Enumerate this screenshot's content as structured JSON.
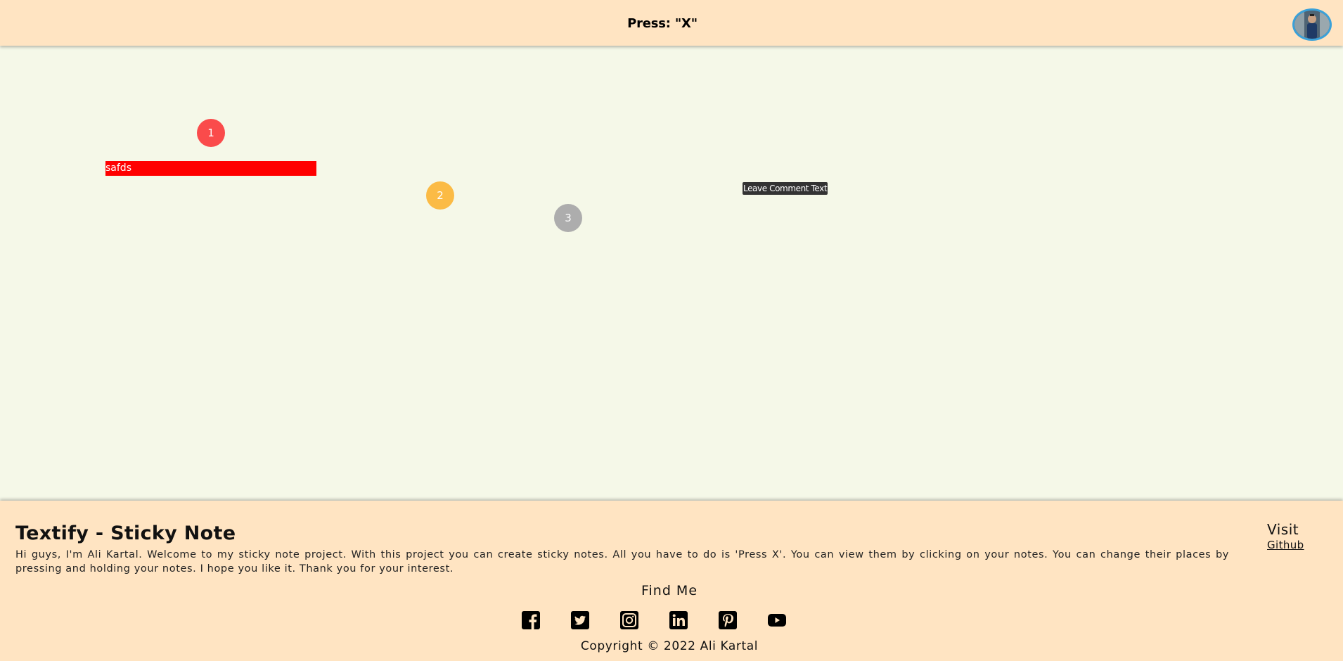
{
  "header": {
    "title": "Press: \"X\""
  },
  "notes": [
    {
      "number": "1",
      "color": "#fa4b4b"
    },
    {
      "number": "2",
      "color": "#fbbb45"
    },
    {
      "number": "3",
      "color": "#adadad"
    }
  ],
  "note_text": "safds",
  "comment_tooltip": "Leave Comment Text",
  "footer": {
    "title": "Textify - Sticky Note",
    "description": "Hi guys, I'm Ali Kartal. Welcome to my sticky note project. With this project you can create sticky notes. All you have to do is 'Press X'. You can view them by clicking on your notes. You can change their places by pressing and holding your notes. I hope you like it. Thank you for your interest.",
    "visit_label": "Visit",
    "github_link": "Github",
    "find_me": "Find Me",
    "social_icons": [
      "facebook-icon",
      "twitter-icon",
      "instagram-icon",
      "linkedin-icon",
      "pinterest-icon",
      "youtube-icon"
    ],
    "copyright": "Copyright © 2022 Ali Kartal"
  },
  "colors": {
    "header_bg": "#ffe4c2",
    "canvas_bg": "#f5f8e8",
    "note_text_bg": "#ff0000",
    "tooltip_bg": "#333333",
    "avatar_border": "#3aa1d9"
  }
}
